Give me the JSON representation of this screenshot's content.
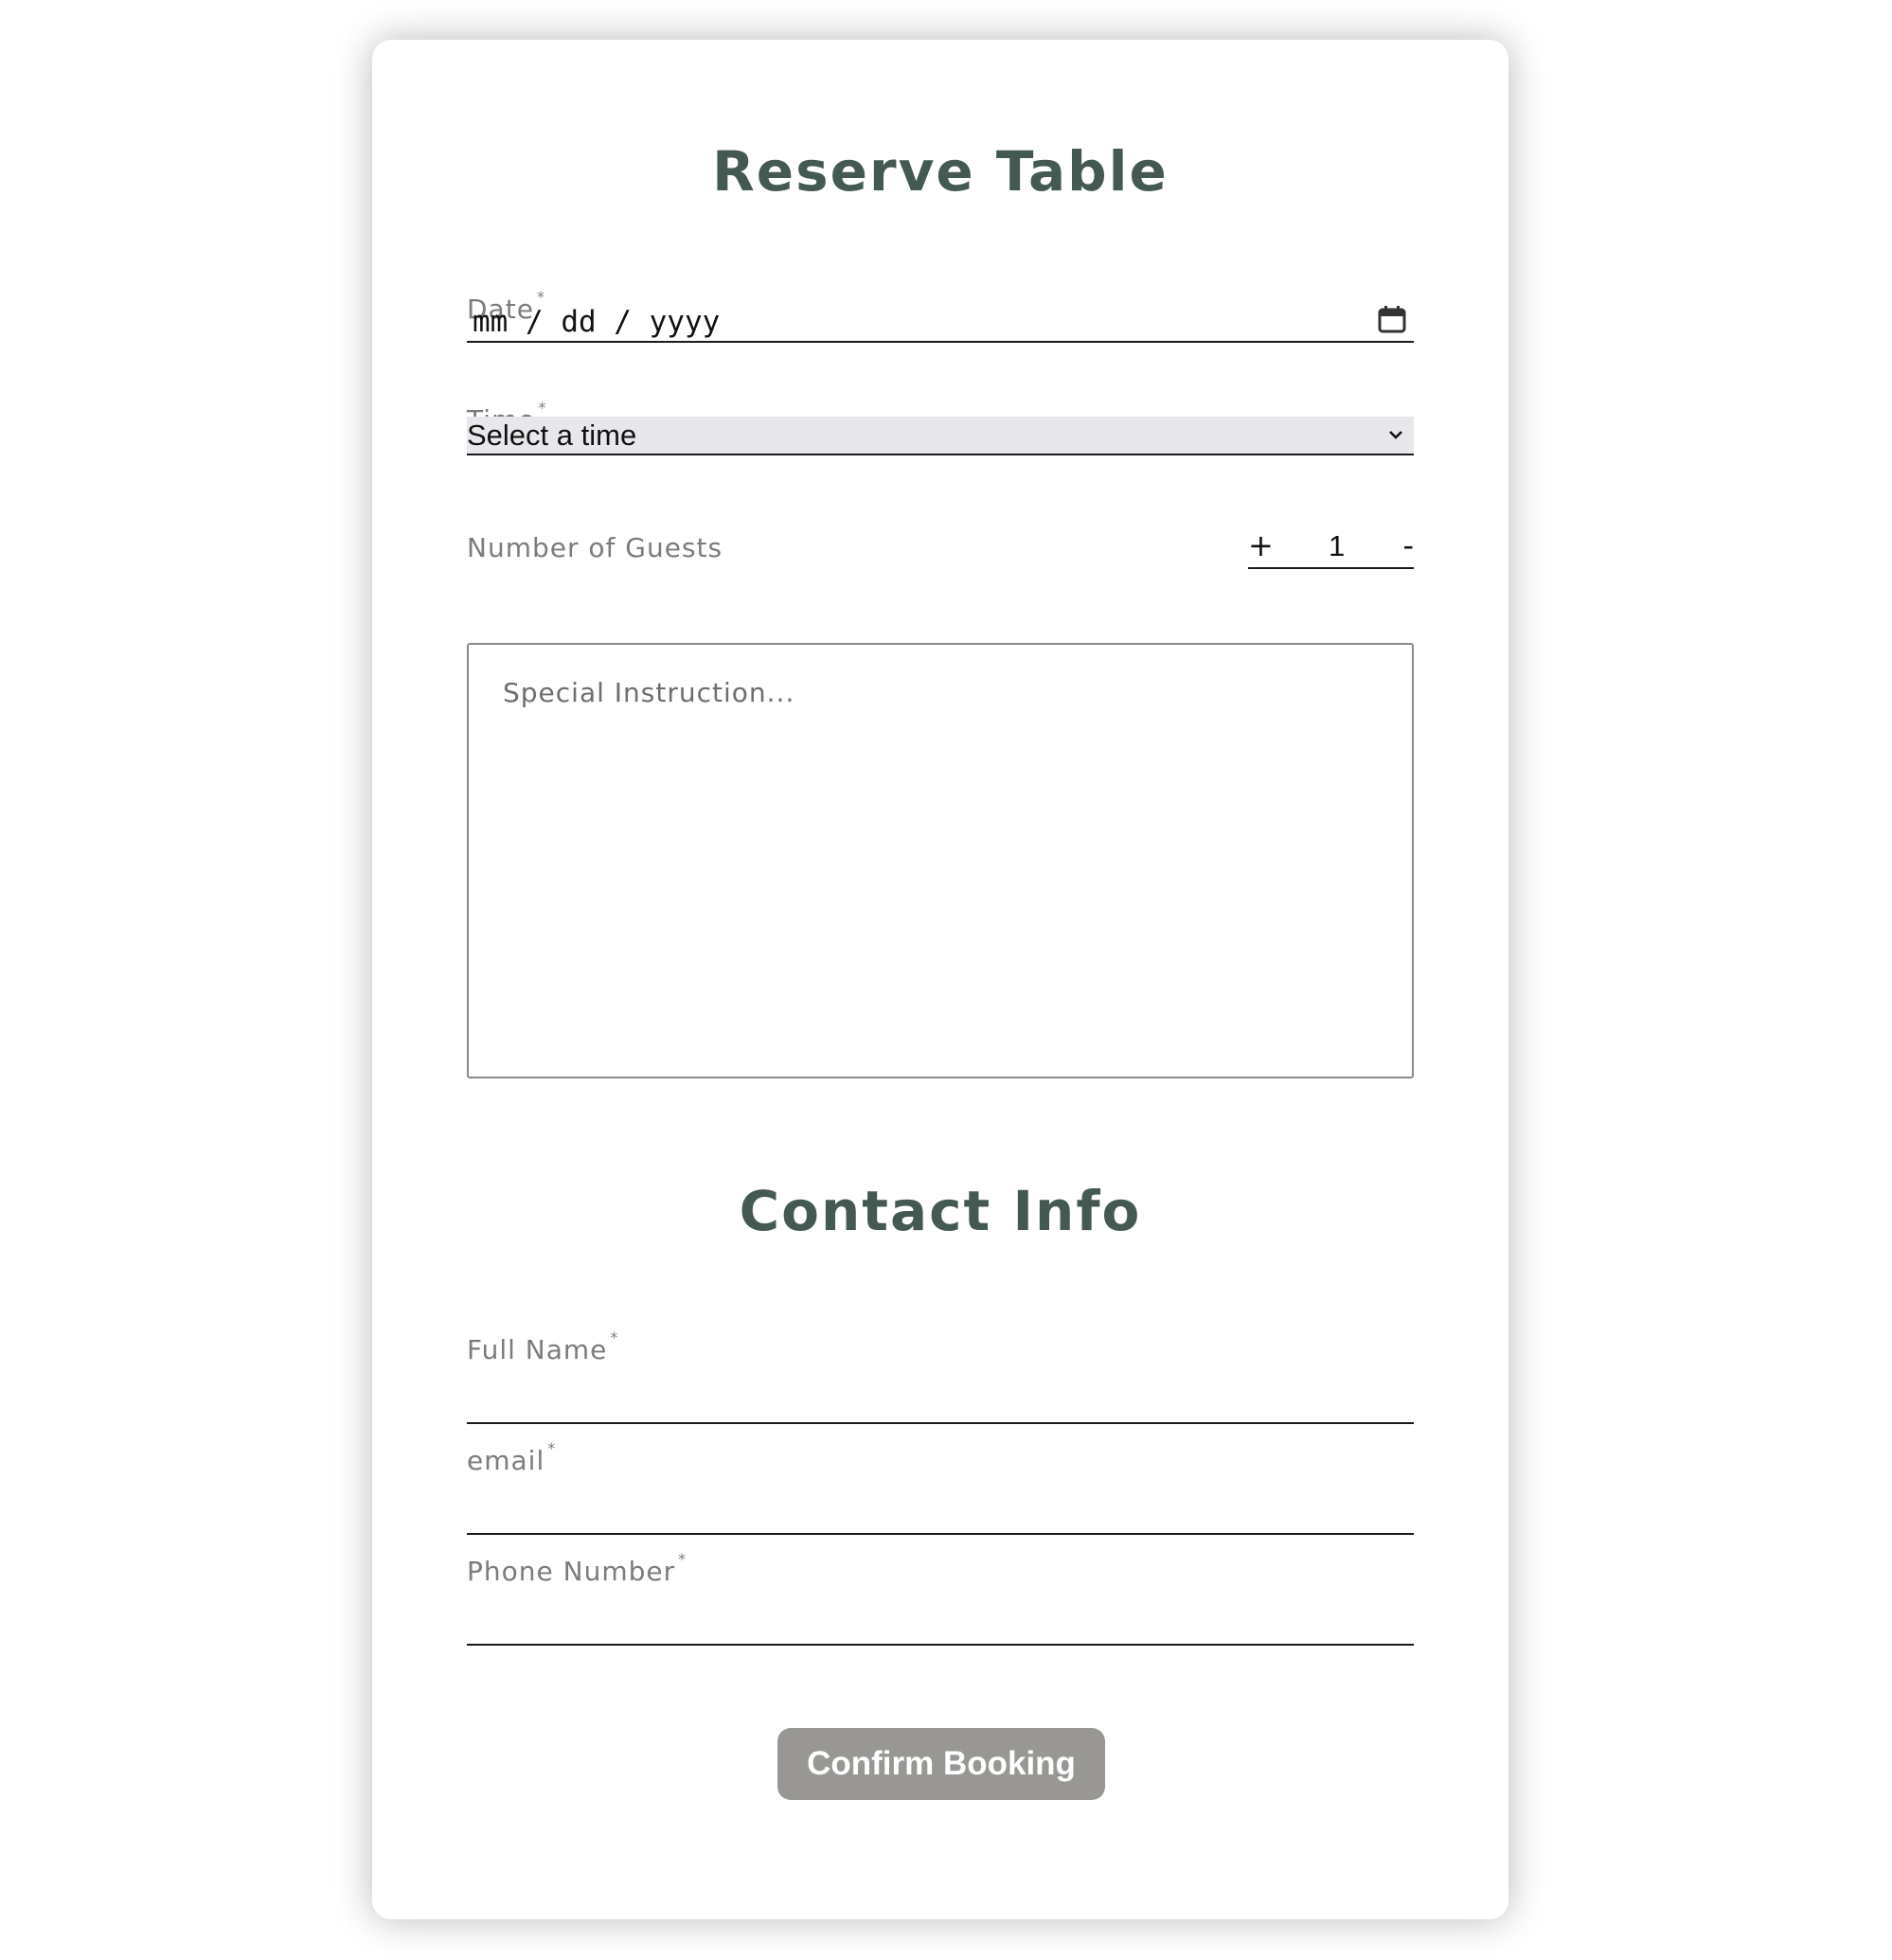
{
  "reservation": {
    "title": "Reserve Table",
    "date": {
      "label": "Date",
      "required_mark": "*",
      "placeholder": "mm / dd / yyyy"
    },
    "time": {
      "label": "Time",
      "required_mark": "*",
      "selected": "Select a time"
    },
    "guests": {
      "label": "Number of Guests",
      "increment": "+",
      "value": "1",
      "decrement": "-"
    },
    "instructions": {
      "placeholder": "Special Instruction..."
    }
  },
  "contact": {
    "title": "Contact Info",
    "full_name": {
      "label": "Full Name",
      "required_mark": "*"
    },
    "email": {
      "label": "email",
      "required_mark": "*"
    },
    "phone": {
      "label": "Phone Number",
      "required_mark": "*"
    }
  },
  "actions": {
    "confirm_label": "Confirm Booking"
  },
  "colors": {
    "heading": "#445a50",
    "button": "#999794"
  },
  "icons": {
    "date": "calendar-icon",
    "time": "chevron-down-icon"
  }
}
